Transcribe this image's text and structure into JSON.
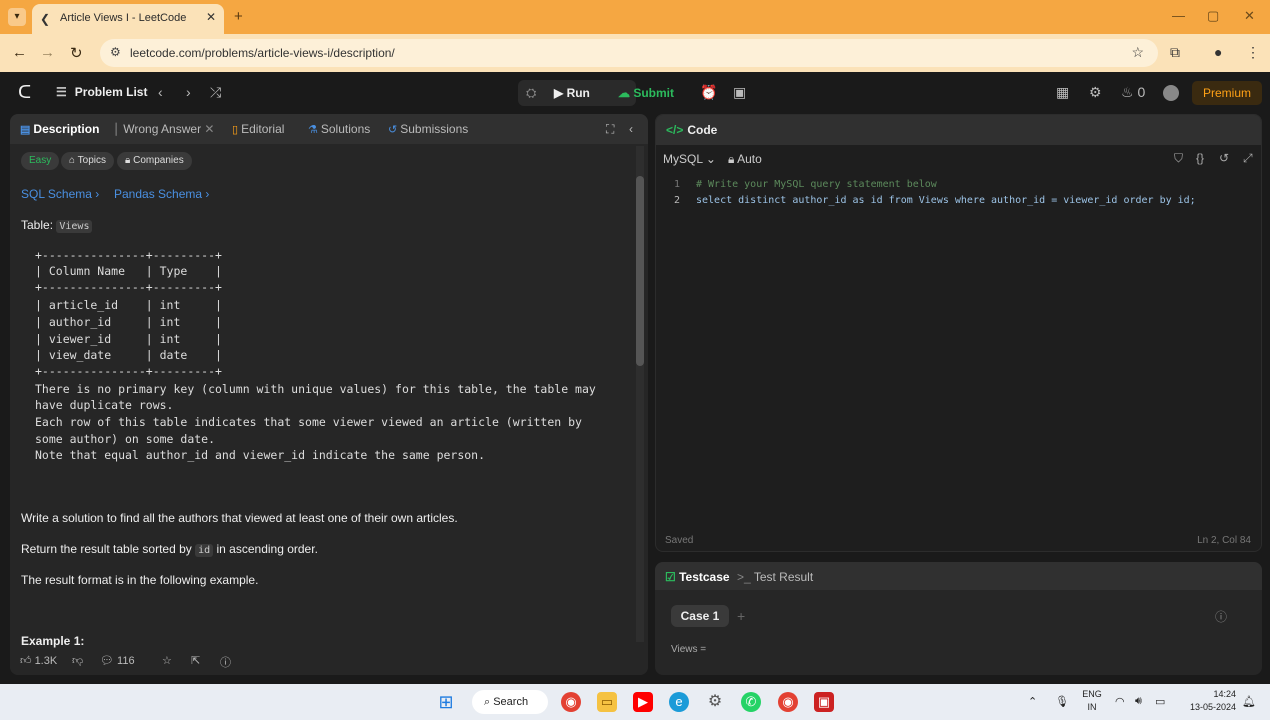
{
  "browser": {
    "tab_title": "Article Views I - LeetCode",
    "url": "leetcode.com/problems/article-views-i/description/"
  },
  "header": {
    "problem_list": "Problem List",
    "run": "Run",
    "submit": "Submit",
    "streak": "0",
    "premium": "Premium"
  },
  "left_tabs": {
    "description": "Description",
    "wrong_answer": "Wrong Answer",
    "editorial": "Editorial",
    "solutions": "Solutions",
    "submissions": "Submissions"
  },
  "tags": {
    "difficulty": "Easy",
    "topics": "Topics",
    "companies": "Companies"
  },
  "schema": {
    "sql": "SQL Schema",
    "pandas": "Pandas Schema"
  },
  "description": {
    "table_label": "Table:",
    "table_name": "Views",
    "schema_lines": [
      "+---------------+---------+",
      "| Column Name   | Type    |",
      "+---------------+---------+",
      "| article_id    | int     |",
      "| author_id     | int     |",
      "| viewer_id     | int     |",
      "| view_date     | date    |",
      "+---------------+---------+",
      "There is no primary key (column with unique values) for this table, the table may",
      "have duplicate rows.",
      "Each row of this table indicates that some viewer viewed an article (written by",
      "some author) on some date.",
      "Note that equal author_id and viewer_id indicate the same person."
    ],
    "task": "Write a solution to find all the authors that viewed at least one of their own articles.",
    "sort_prefix": "Return the result table sorted by",
    "sort_col": "id",
    "sort_suffix": "in ascending order.",
    "format": "The result format is in the following example.",
    "example": "Example 1:"
  },
  "footer": {
    "likes": "1.3K",
    "comments": "116"
  },
  "code": {
    "title": "Code",
    "language": "MySQL",
    "mode": "Auto",
    "lines": [
      {
        "num": "1",
        "text": "# Write your MySQL query statement below"
      },
      {
        "num": "2",
        "text": "select distinct author_id as id from Views where author_id = viewer_id order by id;"
      }
    ],
    "saved": "Saved",
    "cursor": "Ln 2, Col 84"
  },
  "testcase": {
    "tab_testcase": "Testcase",
    "tab_result": "Test Result",
    "case": "Case 1",
    "views_label": "Views ="
  },
  "taskbar": {
    "search": "Search",
    "lang_top": "ENG",
    "lang_bottom": "IN",
    "time": "14:24",
    "date": "13-05-2024"
  }
}
